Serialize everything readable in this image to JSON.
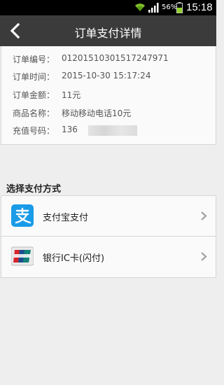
{
  "status_bar": {
    "battery_text": "56%",
    "time": "15:18"
  },
  "header": {
    "title": "订单支付详情"
  },
  "order_info": {
    "rows": [
      {
        "label": "订单编号：",
        "value": "01201510301517247971"
      },
      {
        "label": "订单时间：",
        "value": "2015-10-30 15:17:24"
      },
      {
        "label": "订单金额：",
        "value": "11元"
      },
      {
        "label": "商品名称：",
        "value": "移动移动电话10元"
      },
      {
        "label": "充值号码：",
        "value": "136"
      }
    ]
  },
  "payment": {
    "section_title": "选择支付方式",
    "methods": [
      {
        "label": "支付宝支付",
        "icon": "alipay-icon"
      },
      {
        "label": "银行IC卡(闪付)",
        "icon": "unionpay-icon"
      }
    ]
  },
  "colors": {
    "title_bar": "#3b3b3b",
    "alipay_blue": "#1a9be8",
    "background": "#eeeeee"
  }
}
